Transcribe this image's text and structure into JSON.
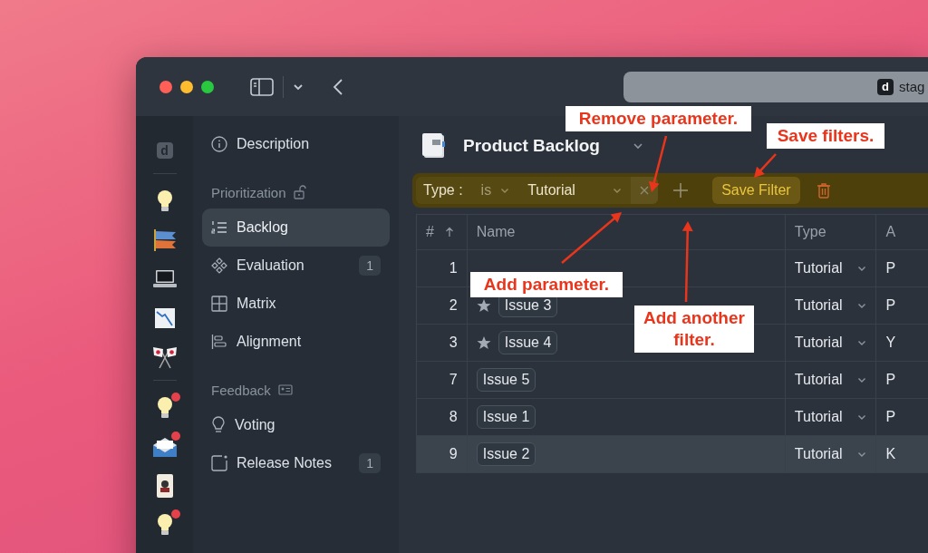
{
  "window": {
    "url": "stag",
    "favicon": "d"
  },
  "rail": [
    {
      "kind": "logo",
      "text": "d",
      "unread": false
    },
    {
      "kind": "bulb",
      "unread": false
    },
    {
      "kind": "streamer",
      "unread": false
    },
    {
      "kind": "laptop",
      "unread": false
    },
    {
      "kind": "chart",
      "unread": false
    },
    {
      "kind": "flags",
      "unread": false
    },
    {
      "kind": "bulb",
      "unread": true
    },
    {
      "kind": "mail",
      "unread": true
    },
    {
      "kind": "card",
      "unread": false
    },
    {
      "kind": "bulb",
      "unread": true
    }
  ],
  "sidebar": [
    {
      "kind": "item",
      "label": "Description",
      "selected": false
    },
    {
      "kind": "section",
      "label": "Prioritization"
    },
    {
      "kind": "item",
      "label": "Backlog",
      "selected": true
    },
    {
      "kind": "item",
      "label": "Evaluation",
      "count": "1",
      "selected": false
    },
    {
      "kind": "item",
      "label": "Matrix",
      "selected": false
    },
    {
      "kind": "item",
      "label": "Alignment",
      "selected": false
    },
    {
      "kind": "section",
      "label": "Feedback"
    },
    {
      "kind": "item",
      "label": "Voting",
      "selected": false
    },
    {
      "kind": "item",
      "label": "Release Notes",
      "count": "1",
      "selected": false
    }
  ],
  "page": {
    "title": "Product Backlog"
  },
  "filter": {
    "field": "Type :",
    "operator": "is",
    "value": "Tutorial",
    "save_label": "Save Filter"
  },
  "table": {
    "columns": [
      "#",
      "Name",
      "Type",
      "A"
    ],
    "rows": [
      {
        "num": "1",
        "type": "Tutorial",
        "column_4": "P",
        "starred": false,
        "selected": false
      },
      {
        "num": "2",
        "name": "Issue 3",
        "type": "Tutorial",
        "column_4": "P",
        "starred": true,
        "selected": false
      },
      {
        "num": "3",
        "name": "Issue 4",
        "type": "Tutorial",
        "column_4": "Y",
        "starred": true,
        "selected": false
      },
      {
        "num": "7",
        "name": "Issue 5",
        "type": "Tutorial",
        "column_4": "P",
        "starred": false,
        "selected": false
      },
      {
        "num": "8",
        "name": "Issue 1",
        "type": "Tutorial",
        "column_4": "P",
        "starred": false,
        "selected": false
      },
      {
        "num": "9",
        "name": "Issue 2",
        "type": "Tutorial",
        "column_4": "K",
        "starred": false,
        "selected": true
      }
    ]
  },
  "annotations": [
    {
      "text": "Remove parameter."
    },
    {
      "text": "Save filters."
    },
    {
      "text": "Add parameter."
    },
    {
      "text": "Add another filter."
    }
  ]
}
